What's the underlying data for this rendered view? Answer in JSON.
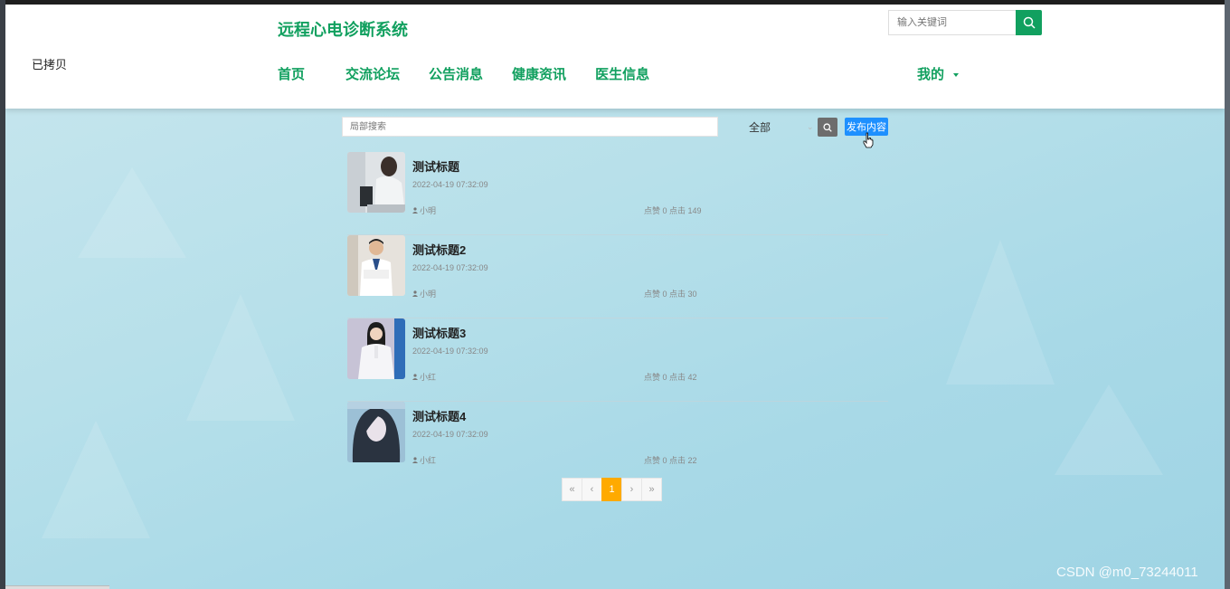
{
  "header": {
    "logo_text": "已拷贝",
    "site_title": "远程心电诊断系统",
    "nav": [
      {
        "label": "首页"
      },
      {
        "label": "交流论坛"
      },
      {
        "label": "公告消息"
      },
      {
        "label": "健康资讯"
      },
      {
        "label": "医生信息"
      }
    ],
    "me_label": "我的",
    "search_placeholder": "输入关键词",
    "accent_color": "#11a05f"
  },
  "filter": {
    "local_search_placeholder": "局部搜索",
    "category_selected": "全部",
    "publish_label": "发布内容"
  },
  "posts": [
    {
      "title": "测试标题",
      "date": "2022-04-19 07:32:09",
      "author": "小明",
      "stats": "点赞 0 点击 149",
      "thumb_icon": "doctor-desk-photo"
    },
    {
      "title": "测试标题2",
      "date": "2022-04-19 07:32:09",
      "author": "小明",
      "stats": "点赞 0 点击 30",
      "thumb_icon": "male-doctor-photo"
    },
    {
      "title": "测试标题3",
      "date": "2022-04-19 07:32:09",
      "author": "小红",
      "stats": "点赞 0 点击 42",
      "thumb_icon": "female-doctor-photo"
    },
    {
      "title": "测试标题4",
      "date": "2022-04-19 07:32:09",
      "author": "小红",
      "stats": "点赞 0 点击 22",
      "thumb_icon": "portrait-photo"
    }
  ],
  "pagination": {
    "first": "«",
    "prev": "‹",
    "current": "1",
    "next": "›",
    "last": "»"
  },
  "watermark": "CSDN @m0_73244011"
}
